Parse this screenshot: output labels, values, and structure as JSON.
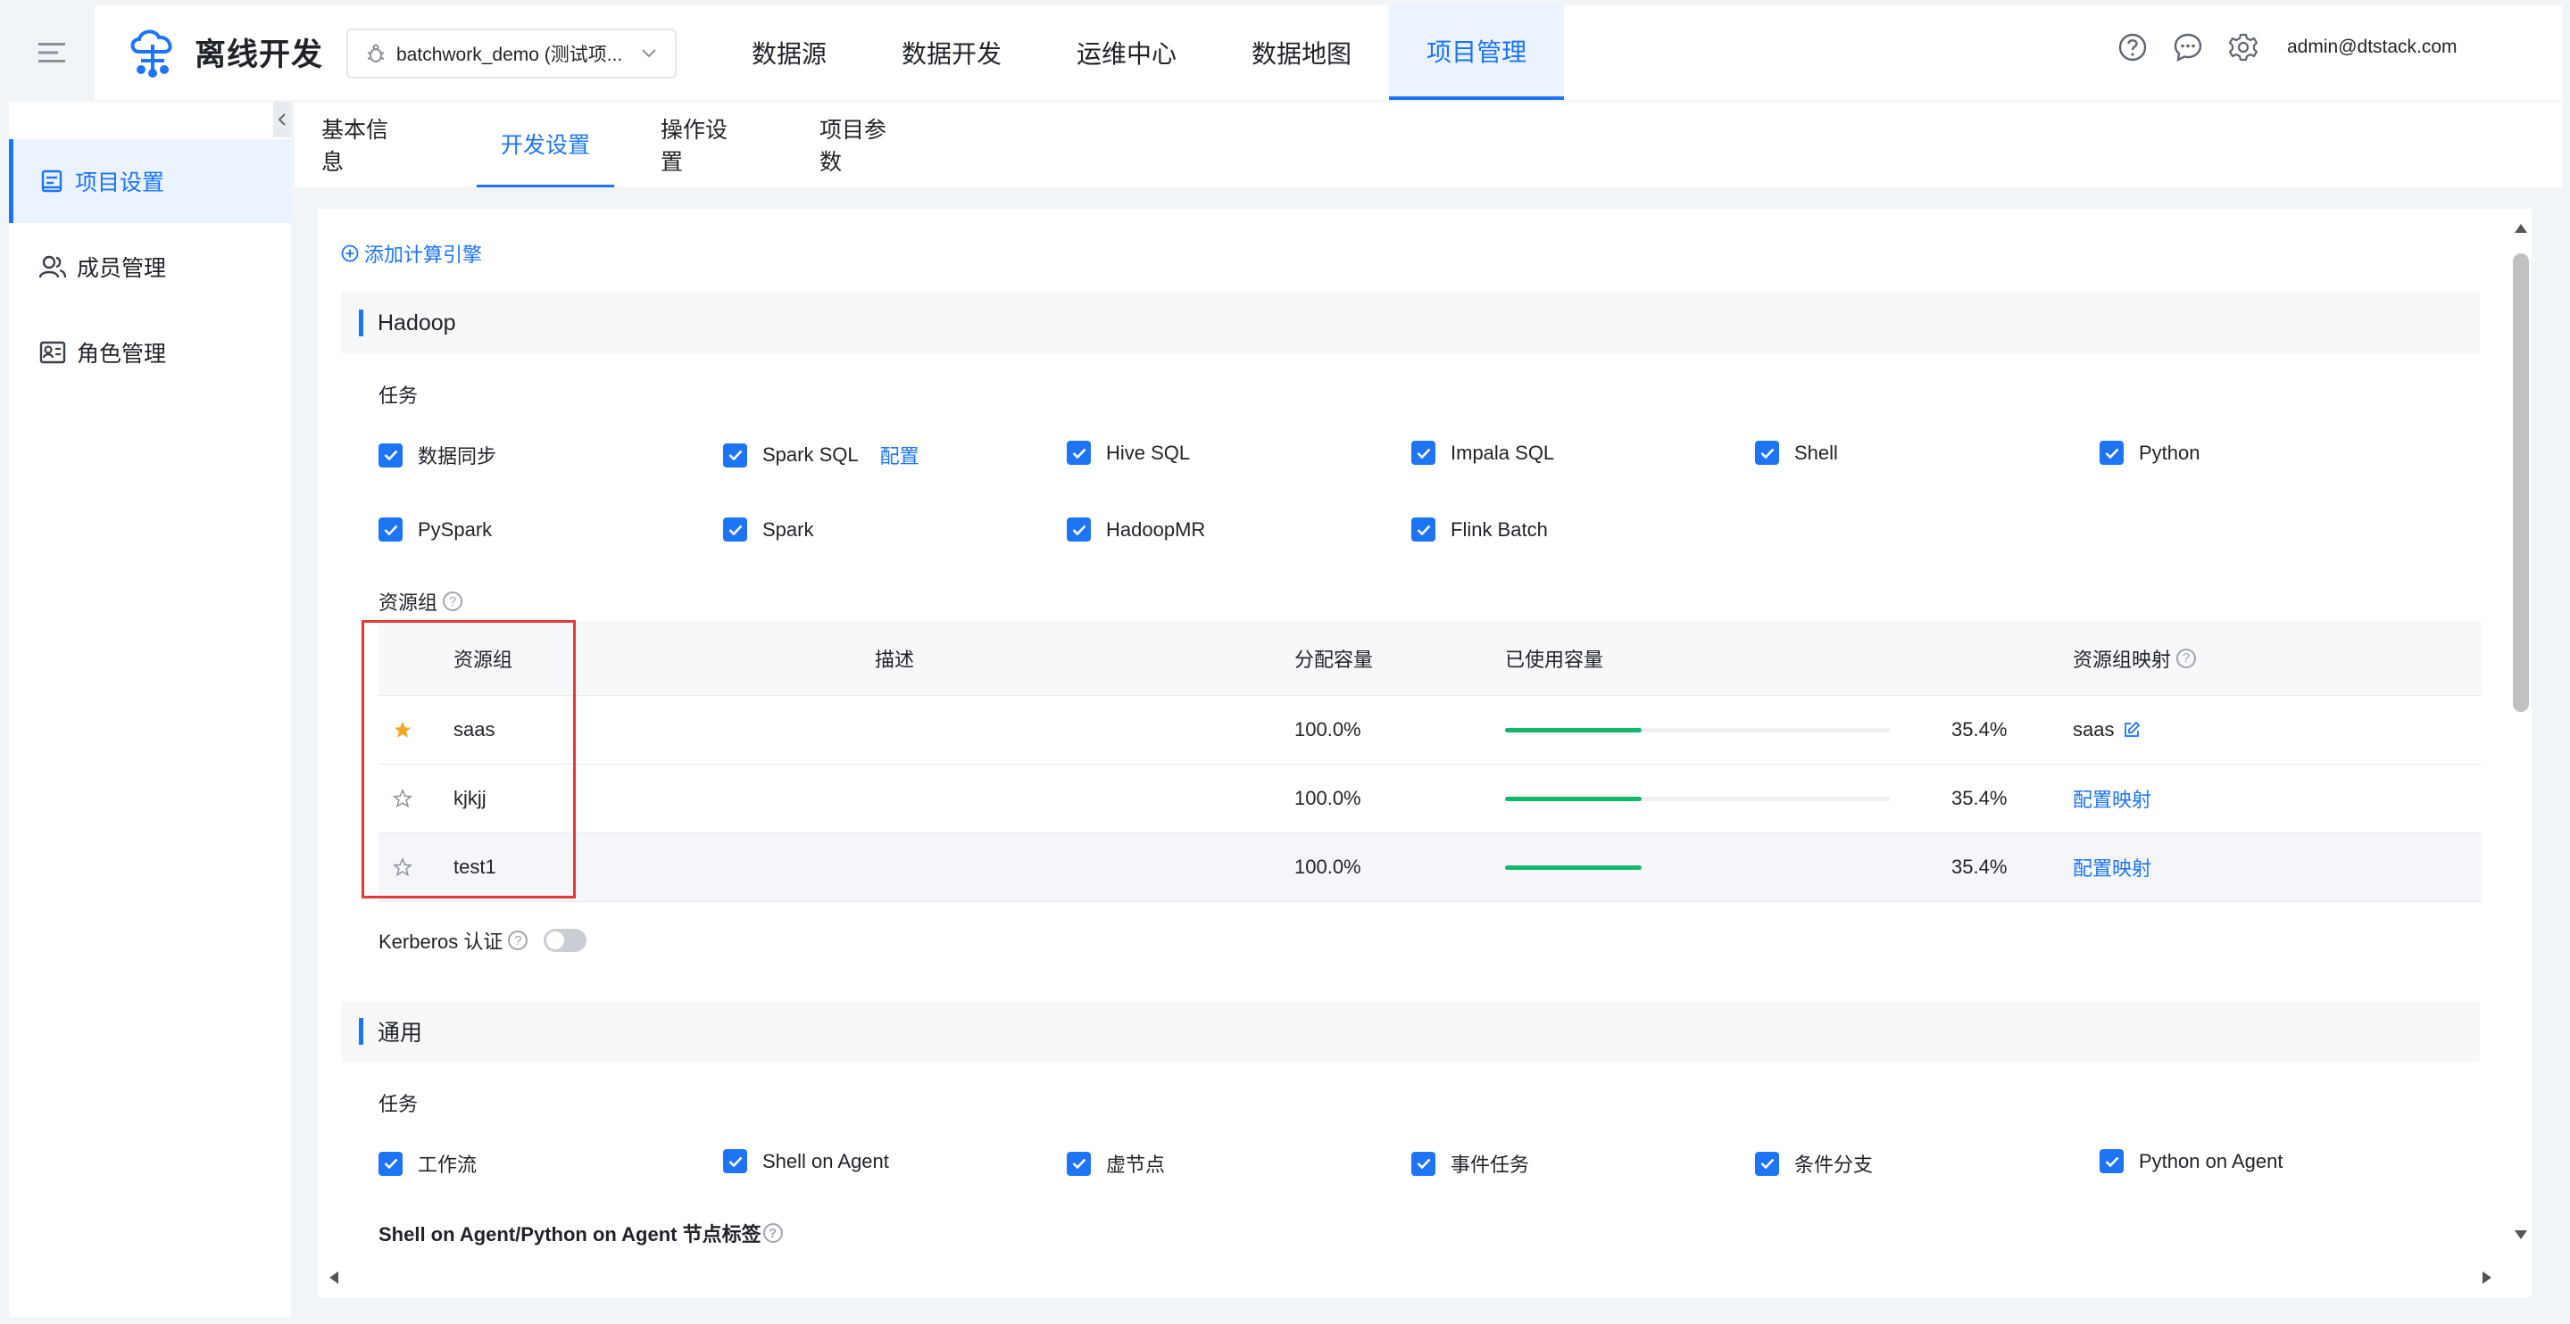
{
  "app": {
    "title": "离线开发",
    "user": "admin@dtstack.com"
  },
  "project_selector": {
    "value": "batchwork_demo (测试项..."
  },
  "nav": {
    "items": [
      "数据源",
      "数据开发",
      "运维中心",
      "数据地图",
      "项目管理"
    ],
    "active": "项目管理"
  },
  "sidebar": {
    "items": [
      {
        "label": "项目设置",
        "icon": "project-settings-icon"
      },
      {
        "label": "成员管理",
        "icon": "members-icon"
      },
      {
        "label": "角色管理",
        "icon": "role-card-icon"
      }
    ]
  },
  "tabs": {
    "items": [
      "基本信息",
      "开发设置",
      "操作设置",
      "项目参数"
    ],
    "active": "开发设置"
  },
  "add_engine": "添加计算引擎",
  "hadoop": {
    "title": "Hadoop",
    "tasks_label": "任务",
    "tasks": [
      "数据同步",
      "Spark SQL",
      "Hive SQL",
      "Impala SQL",
      "Shell",
      "Python",
      "PySpark",
      "Spark",
      "HadoopMR",
      "Flink Batch"
    ],
    "spark_sql_link": "配置",
    "resource_group_label": "资源组",
    "table": {
      "headers": [
        "资源组",
        "描述",
        "分配容量",
        "已使用容量",
        "资源组映射"
      ],
      "rows": [
        {
          "name": "saas",
          "starred": true,
          "desc": "",
          "allocated": "100.0%",
          "used": "35.4%",
          "used_fraction": 0.354,
          "mapping": "saas",
          "mapping_is_link": false
        },
        {
          "name": "kjkjj",
          "starred": false,
          "desc": "",
          "allocated": "100.0%",
          "used": "35.4%",
          "used_fraction": 0.354,
          "mapping": "配置映射",
          "mapping_is_link": true
        },
        {
          "name": "test1",
          "starred": false,
          "desc": "",
          "allocated": "100.0%",
          "used": "35.4%",
          "used_fraction": 0.354,
          "mapping": "配置映射",
          "mapping_is_link": true
        }
      ]
    },
    "kerberos_label": "Kerberos 认证",
    "kerberos_enabled": false
  },
  "general": {
    "title": "通用",
    "tasks_label": "任务",
    "tasks": [
      "工作流",
      "Shell on Agent",
      "虚节点",
      "事件任务",
      "条件分支",
      "Python on Agent"
    ],
    "agent_label": "Shell on Agent/Python on Agent 节点标签"
  },
  "colors": {
    "accent": "#1d74f5",
    "progress": "#12b76a",
    "star": "#f5a623",
    "highlight": "#e53935"
  }
}
